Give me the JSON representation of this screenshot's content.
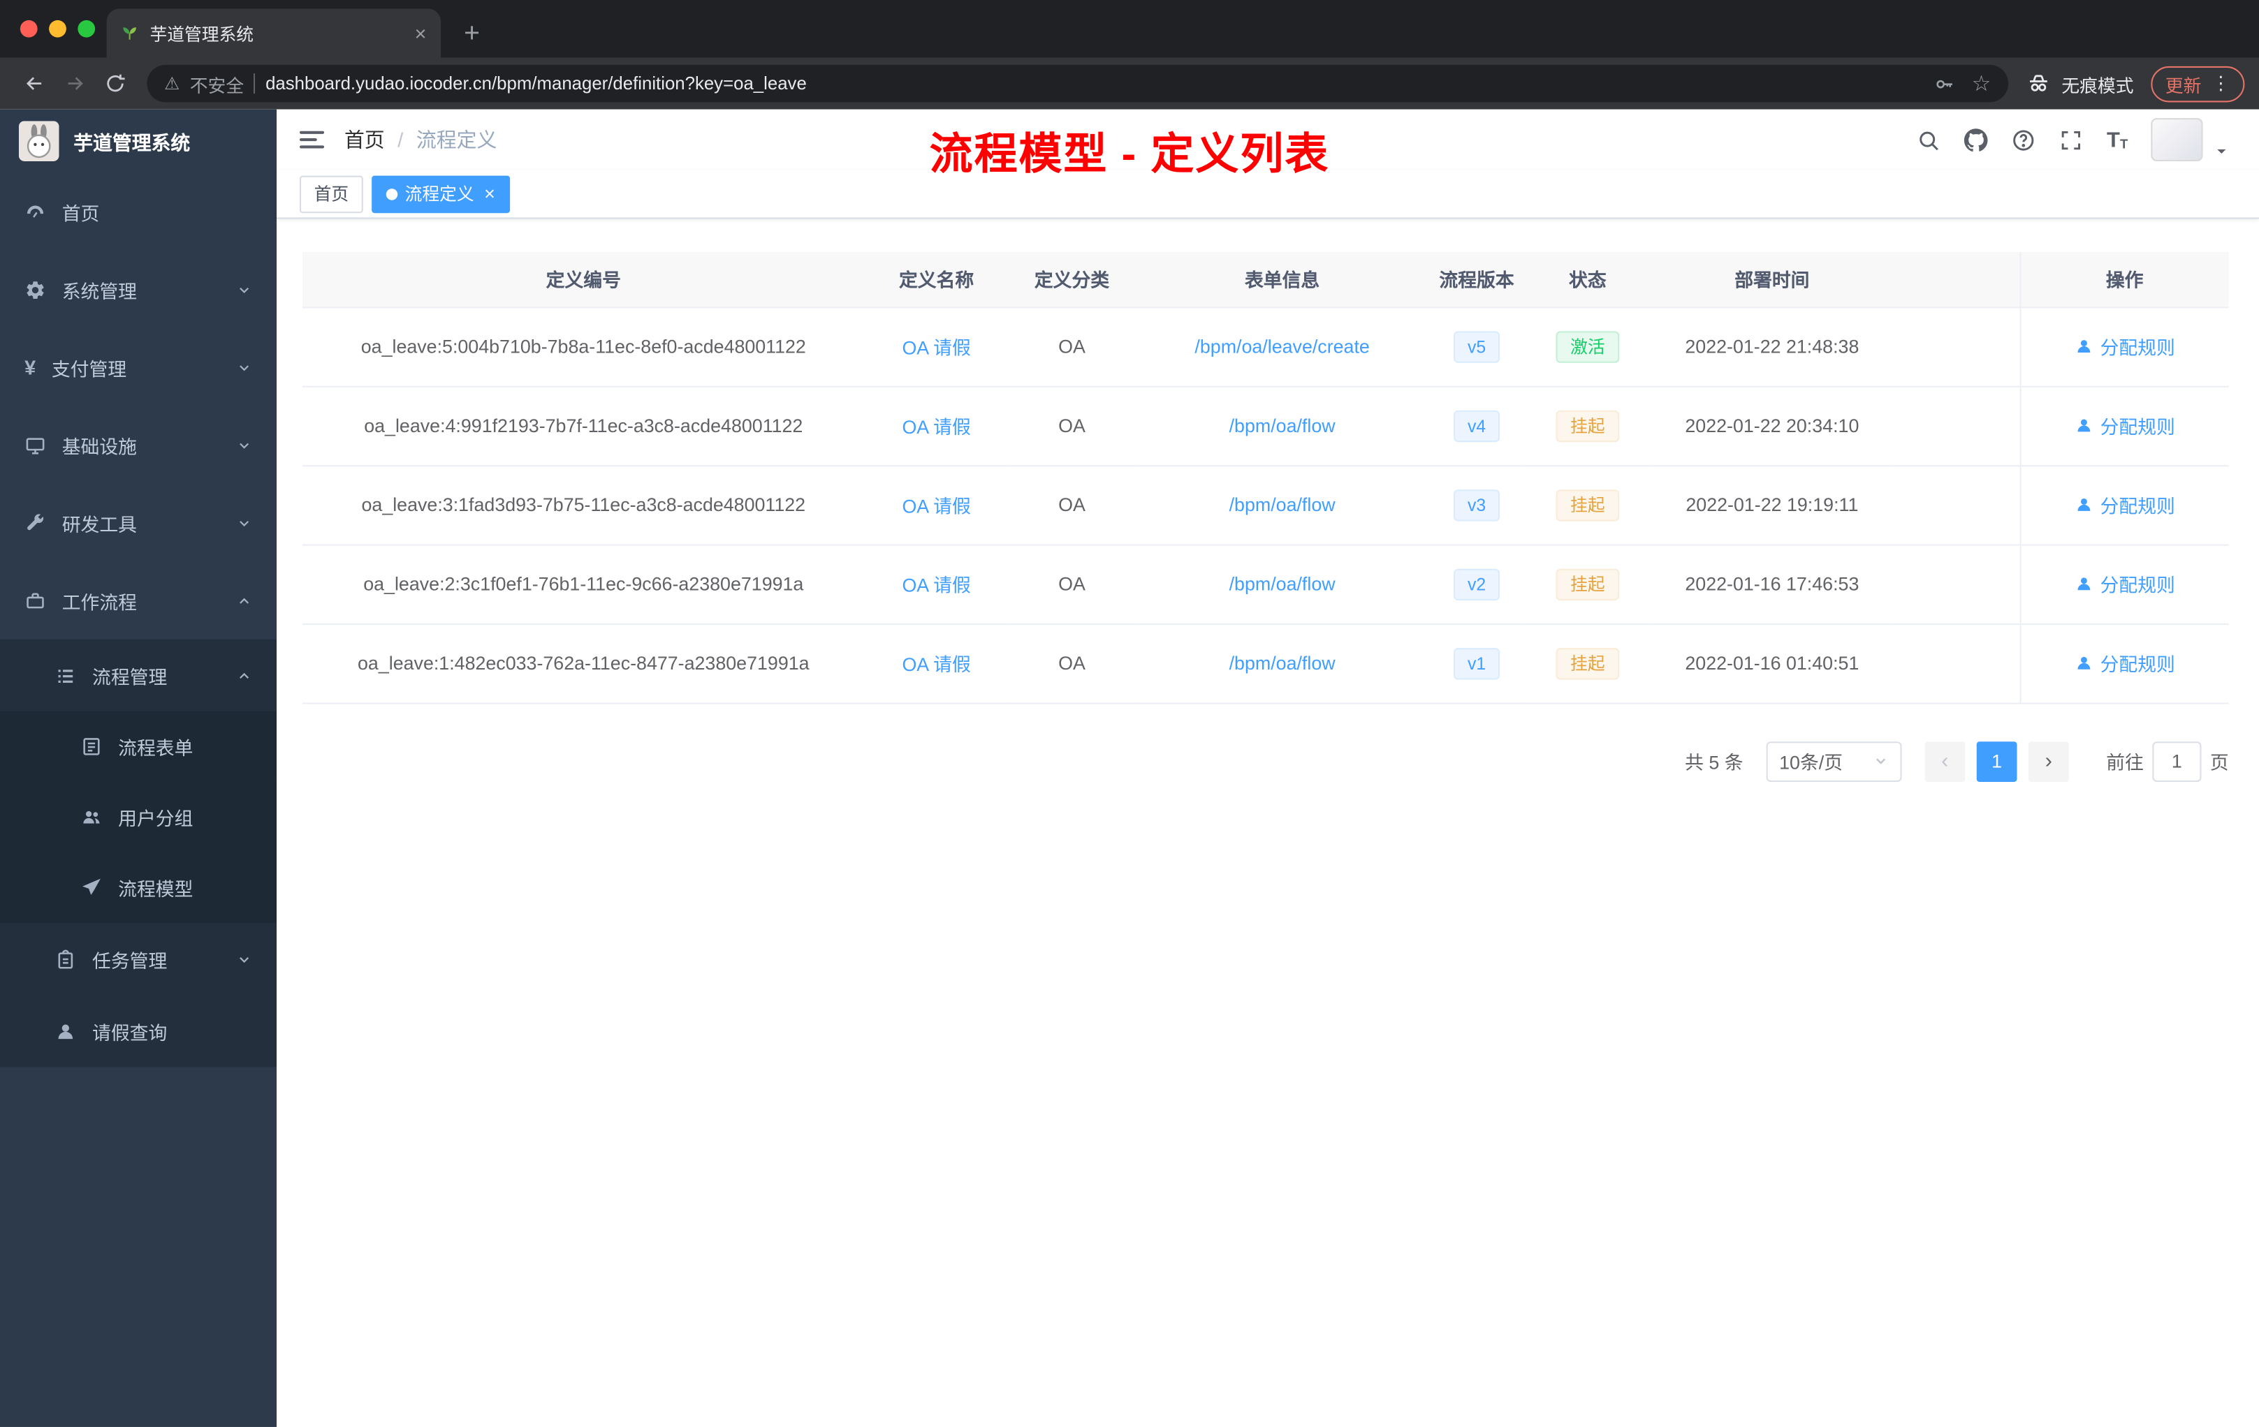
{
  "colors": {
    "accent_blue": "#409eff",
    "annotation_red": "#ff0000",
    "success_green": "#13ce66",
    "warning_orange": "#e6a23c",
    "sidebar_bg": "#2d3a4b"
  },
  "browser": {
    "tab_title": "芋道管理系统",
    "security_label": "不安全",
    "url": "dashboard.yudao.iocoder.cn/bpm/manager/definition?key=oa_leave",
    "incognito_label": "无痕模式",
    "update_label": "更新"
  },
  "glyphs": {
    "close": "×",
    "plus": "+",
    "star": "☆",
    "warning": "⚠",
    "kebab": "⋮",
    "slash": "/",
    "prev": "‹",
    "next": "›"
  },
  "sidebar": {
    "logo_title": "芋道管理系统",
    "items": [
      {
        "label": "首页"
      },
      {
        "label": "系统管理"
      },
      {
        "label": "支付管理"
      },
      {
        "label": "基础设施"
      },
      {
        "label": "研发工具"
      },
      {
        "label": "工作流程"
      },
      {
        "label": "流程管理"
      },
      {
        "label": "流程表单"
      },
      {
        "label": "用户分组"
      },
      {
        "label": "流程模型"
      },
      {
        "label": "任务管理"
      },
      {
        "label": "请假查询"
      }
    ]
  },
  "header": {
    "breadcrumb_home": "首页",
    "breadcrumb_current": "流程定义",
    "annotation": "流程模型 - 定义列表"
  },
  "tags": {
    "home": "首页",
    "active": "流程定义"
  },
  "table": {
    "columns": [
      "定义编号",
      "定义名称",
      "定义分类",
      "表单信息",
      "流程版本",
      "状态",
      "部署时间",
      "操作"
    ],
    "action_label": "分配规则",
    "rows": [
      {
        "id": "oa_leave:5:004b710b-7b8a-11ec-8ef0-acde48001122",
        "name": "OA 请假",
        "category": "OA",
        "form": "/bpm/oa/leave/create",
        "version": "v5",
        "status": "激活",
        "status_type": "success",
        "time": "2022-01-22 21:48:38"
      },
      {
        "id": "oa_leave:4:991f2193-7b7f-11ec-a3c8-acde48001122",
        "name": "OA 请假",
        "category": "OA",
        "form": "/bpm/oa/flow",
        "version": "v4",
        "status": "挂起",
        "status_type": "warning",
        "time": "2022-01-22 20:34:10"
      },
      {
        "id": "oa_leave:3:1fad3d93-7b75-11ec-a3c8-acde48001122",
        "name": "OA 请假",
        "category": "OA",
        "form": "/bpm/oa/flow",
        "version": "v3",
        "status": "挂起",
        "status_type": "warning",
        "time": "2022-01-22 19:19:11"
      },
      {
        "id": "oa_leave:2:3c1f0ef1-76b1-11ec-9c66-a2380e71991a",
        "name": "OA 请假",
        "category": "OA",
        "form": "/bpm/oa/flow",
        "version": "v2",
        "status": "挂起",
        "status_type": "warning",
        "time": "2022-01-16 17:46:53"
      },
      {
        "id": "oa_leave:1:482ec033-762a-11ec-8477-a2380e71991a",
        "name": "OA 请假",
        "category": "OA",
        "form": "/bpm/oa/flow",
        "version": "v1",
        "status": "挂起",
        "status_type": "warning",
        "time": "2022-01-16 01:40:51"
      }
    ]
  },
  "pagination": {
    "total": "共 5 条",
    "page_size": "10条/页",
    "page": "1",
    "goto_label": "前往",
    "goto_value": "1",
    "unit_label": "页"
  }
}
